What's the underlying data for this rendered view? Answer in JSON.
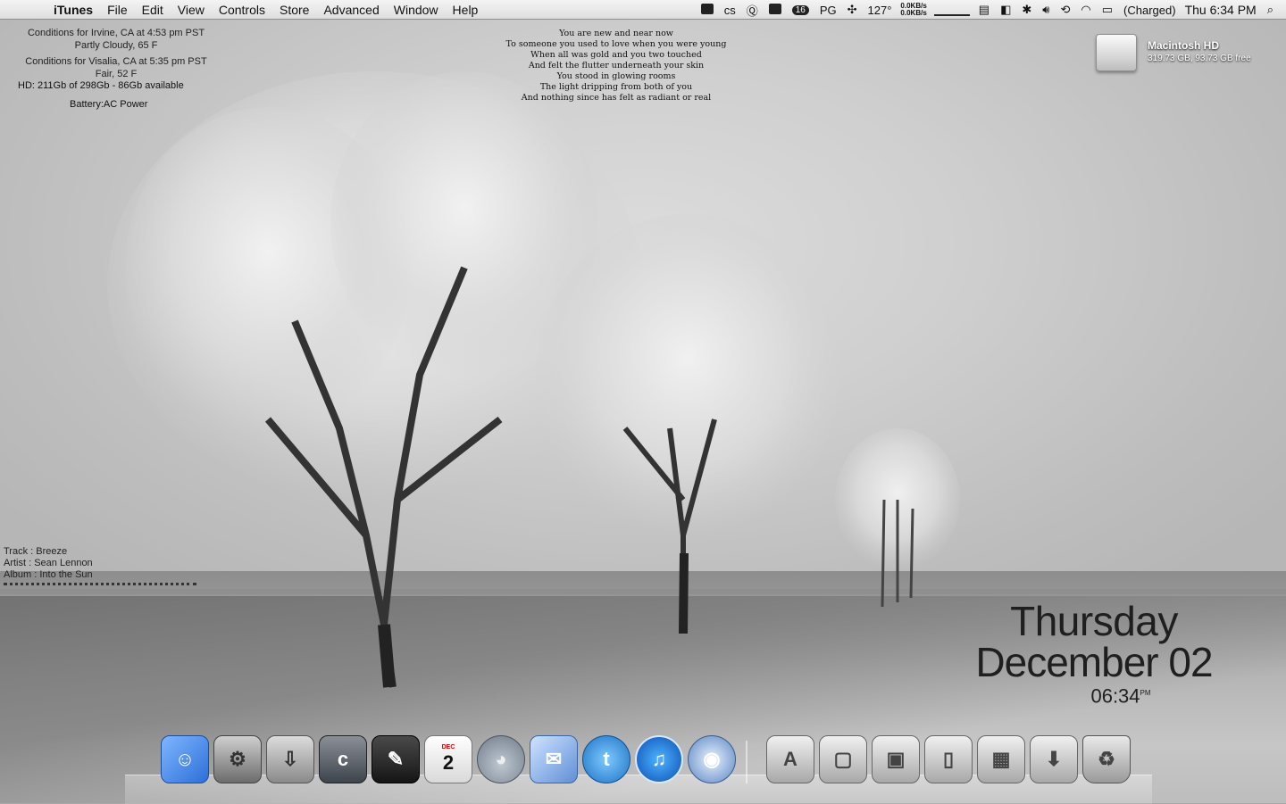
{
  "menubar": {
    "app_name": "iTunes",
    "menus": [
      "File",
      "Edit",
      "View",
      "Controls",
      "Store",
      "Advanced",
      "Window",
      "Help"
    ],
    "status": {
      "notification_count": "16",
      "keyboard": "PG",
      "temperature": "127°",
      "net_up": "0.0KB/s",
      "net_down": "0.0KB/s",
      "battery_state": "(Charged)",
      "clock": "Thu 6:34 PM"
    }
  },
  "weather": {
    "line1": "Conditions for Irvine, CA at 4:53 pm PST",
    "line2": "Partly Cloudy, 65 F",
    "line3": "Conditions for Visalia, CA at 5:35 pm PST",
    "line4": "Fair, 52 F"
  },
  "system": {
    "hd": "HD:  211Gb of 298Gb - 86Gb available",
    "battery": "Battery:AC Power"
  },
  "lyrics": [
    "You are new and near now",
    "To someone you used to love when you were young",
    "When all was gold and you two touched",
    "And felt the flutter underneath your skin",
    "You stood in glowing rooms",
    "The light dripping from both of you",
    "And nothing since has felt as radiant or real"
  ],
  "now_playing": {
    "track": "Track  : Breeze",
    "artist": "Artist : Sean Lennon",
    "album": "Album  : Into the Sun"
  },
  "disk": {
    "name": "Macintosh HD",
    "free": "319.73 GB, 93.73 GB free"
  },
  "date_widget": {
    "day": "Thursday",
    "date": "December 02",
    "time": "06:34",
    "ampm": "PM"
  },
  "dock": {
    "calendar_month": "DEC",
    "calendar_day": "2"
  },
  "colors": {
    "menubar": "#e8e8e8",
    "wallpaper": "#c9c9c9",
    "text": "#1f1f1f"
  }
}
